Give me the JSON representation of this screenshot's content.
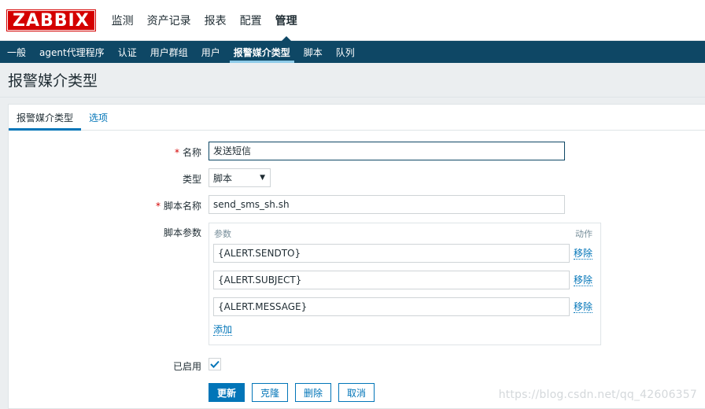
{
  "app": {
    "logo": "ZABBIX"
  },
  "main_menu": [
    {
      "label": "监测",
      "active": false
    },
    {
      "label": "资产记录",
      "active": false
    },
    {
      "label": "报表",
      "active": false
    },
    {
      "label": "配置",
      "active": false
    },
    {
      "label": "管理",
      "active": true
    }
  ],
  "sub_menu": [
    {
      "label": "一般",
      "active": false
    },
    {
      "label": "agent代理程序",
      "active": false
    },
    {
      "label": "认证",
      "active": false
    },
    {
      "label": "用户群组",
      "active": false
    },
    {
      "label": "用户",
      "active": false
    },
    {
      "label": "报警媒介类型",
      "active": true
    },
    {
      "label": "脚本",
      "active": false
    },
    {
      "label": "队列",
      "active": false
    }
  ],
  "page": {
    "title": "报警媒介类型"
  },
  "tabs": [
    {
      "label": "报警媒介类型",
      "active": true
    },
    {
      "label": "选项",
      "active": false
    }
  ],
  "form": {
    "required_mark": "*",
    "name": {
      "label": "名称",
      "value": "发送短信"
    },
    "type": {
      "label": "类型",
      "value": "脚本"
    },
    "script_name": {
      "label": "脚本名称",
      "value": "send_sms_sh.sh"
    },
    "script_params": {
      "label": "脚本参数",
      "col_param": "参数",
      "col_action": "动作",
      "rows": [
        {
          "value": "{ALERT.SENDTO}",
          "action": "移除"
        },
        {
          "value": "{ALERT.SUBJECT}",
          "action": "移除"
        },
        {
          "value": "{ALERT.MESSAGE}",
          "action": "移除"
        }
      ],
      "add_label": "添加"
    },
    "enabled": {
      "label": "已启用",
      "checked": true
    }
  },
  "buttons": {
    "update": "更新",
    "clone": "克隆",
    "delete": "删除",
    "cancel": "取消"
  },
  "watermark": "https://blog.csdn.net/qq_42606357",
  "colors": {
    "brand_red": "#d40000",
    "nav_dark": "#0e4765",
    "link_blue": "#0275b8"
  }
}
